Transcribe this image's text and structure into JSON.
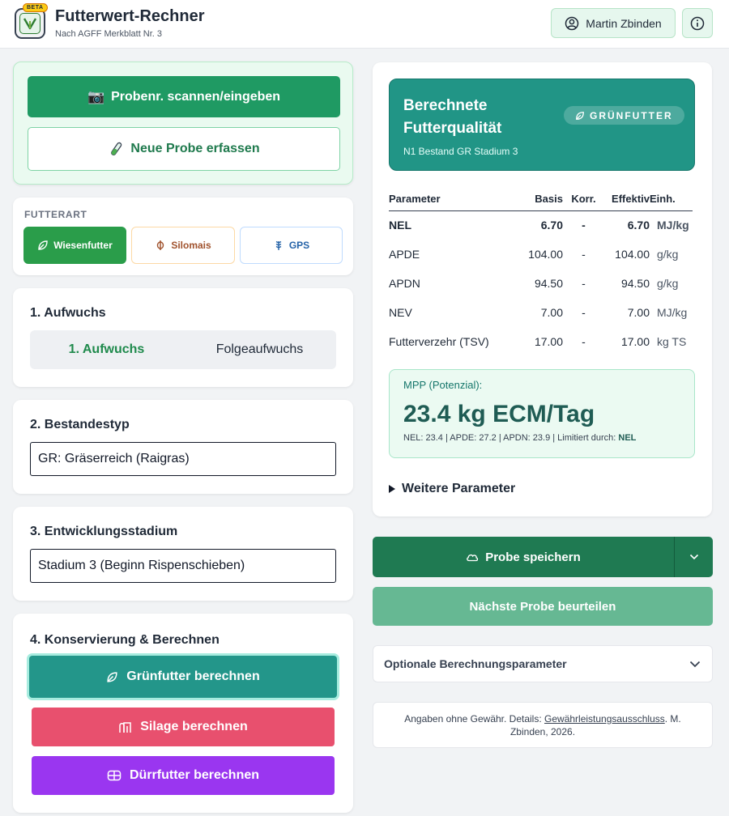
{
  "header": {
    "beta": "BETA",
    "title": "Futterwert-Rechner",
    "subtitle": "Nach AGFF Merkblatt Nr. 3",
    "user_name": "Martin Zbinden"
  },
  "sample": {
    "scan_label": "Probenr. scannen/eingeben",
    "new_label": "Neue Probe erfassen"
  },
  "futterart": {
    "label": "FUTTERART",
    "options": [
      "Wiesenfutter",
      "Silomais",
      "GPS"
    ],
    "selected": "Wiesenfutter"
  },
  "aufwuchs": {
    "title": "1. Aufwuchs",
    "options": [
      "1. Aufwuchs",
      "Folgeaufwuchs"
    ],
    "selected": "1. Aufwuchs"
  },
  "bestandestyp": {
    "title": "2. Bestandestyp",
    "value": "GR: Gräserreich (Raigras)"
  },
  "stadium": {
    "title": "3. Entwicklungsstadium",
    "value": "Stadium 3 (Beginn Rispenschieben)"
  },
  "konservierung": {
    "title": "4. Konservierung & Berechnen",
    "gruen_label": "Grünfutter berechnen",
    "silage_label": "Silage berechnen",
    "duerr_label": "Dürrfutter berechnen"
  },
  "result": {
    "title": "Berechnete Futterqualität",
    "subtitle": "N1 Bestand GR Stadium 3",
    "badge": "GRÜNFUTTER",
    "columns": [
      "Parameter",
      "Basis",
      "Korr.",
      "Effektiv",
      "Einh."
    ],
    "rows": [
      {
        "param": "NEL",
        "basis": "6.70",
        "korr": "-",
        "effektiv": "6.70",
        "unit": "MJ/kg"
      },
      {
        "param": "APDE",
        "basis": "104.00",
        "korr": "-",
        "effektiv": "104.00",
        "unit": "g/kg"
      },
      {
        "param": "APDN",
        "basis": "94.50",
        "korr": "-",
        "effektiv": "94.50",
        "unit": "g/kg"
      },
      {
        "param": "NEV",
        "basis": "7.00",
        "korr": "-",
        "effektiv": "7.00",
        "unit": "MJ/kg"
      },
      {
        "param": "Futterverzehr (TSV)",
        "basis": "17.00",
        "korr": "-",
        "effektiv": "17.00",
        "unit": "kg TS"
      }
    ],
    "mpp_label": "MPP (Potenzial):",
    "mpp_value": "23.4 kg ECM/Tag",
    "mpp_detail": "NEL: 23.4 | APDE: 27.2 | APDN: 23.9 | Limitiert durch: ",
    "mpp_limit": "NEL",
    "more_label": "Weitere Parameter"
  },
  "actions": {
    "save_label": "Probe speichern",
    "next_label": "Nächste Probe beurteilen",
    "optional_label": "Optionale Berechnungsparameter"
  },
  "disclaimer": {
    "prefix": "Angaben ohne Gewähr. Details: ",
    "link": "Gewährleistungsausschluss",
    "suffix": ". M. Zbinden, 2026."
  },
  "colors": {
    "primary_green": "#1f9a63",
    "teal": "#219586",
    "silage_red": "#e8506e",
    "duerr_purple": "#9a36f0"
  }
}
